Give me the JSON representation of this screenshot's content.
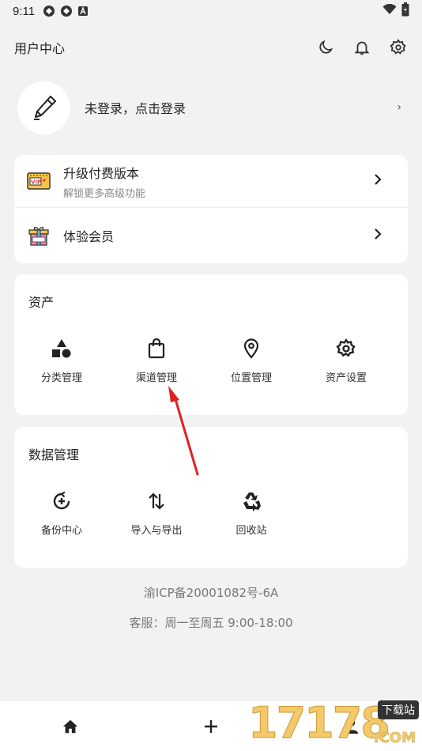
{
  "status_bar": {
    "time": "9:11"
  },
  "header": {
    "title": "用户中心"
  },
  "login": {
    "text": "未登录，点击登录",
    "chevron": "›"
  },
  "promo": {
    "upgrade_title": "升级付费版本",
    "upgrade_subtitle": "解锁更多高级功能",
    "trial_title": "体验会员"
  },
  "assets": {
    "title": "资产",
    "items": [
      {
        "label": "分类管理",
        "icon": "shapes-icon"
      },
      {
        "label": "渠道管理",
        "icon": "shopping-bag-icon"
      },
      {
        "label": "位置管理",
        "icon": "location-pin-icon"
      },
      {
        "label": "资产设置",
        "icon": "gear-icon"
      }
    ]
  },
  "data_management": {
    "title": "数据管理",
    "items": [
      {
        "label": "备份中心",
        "icon": "backup-icon"
      },
      {
        "label": "导入与导出",
        "icon": "import-export-icon"
      },
      {
        "label": "回收站",
        "icon": "recycle-icon"
      }
    ]
  },
  "footer": {
    "icp": "渝ICP备20001082号-6A",
    "service": "客服：周一至周五 9:00-18:00"
  },
  "tabbar": {
    "items": [
      "home-icon",
      "add-icon",
      "user-icon"
    ]
  },
  "watermark": {
    "digits": "17178",
    "tag": "下载站",
    "domain": ".COM"
  },
  "colors": {
    "annotation_arrow": "#e02020",
    "background": "#f2f2f2",
    "card": "#ffffff"
  }
}
